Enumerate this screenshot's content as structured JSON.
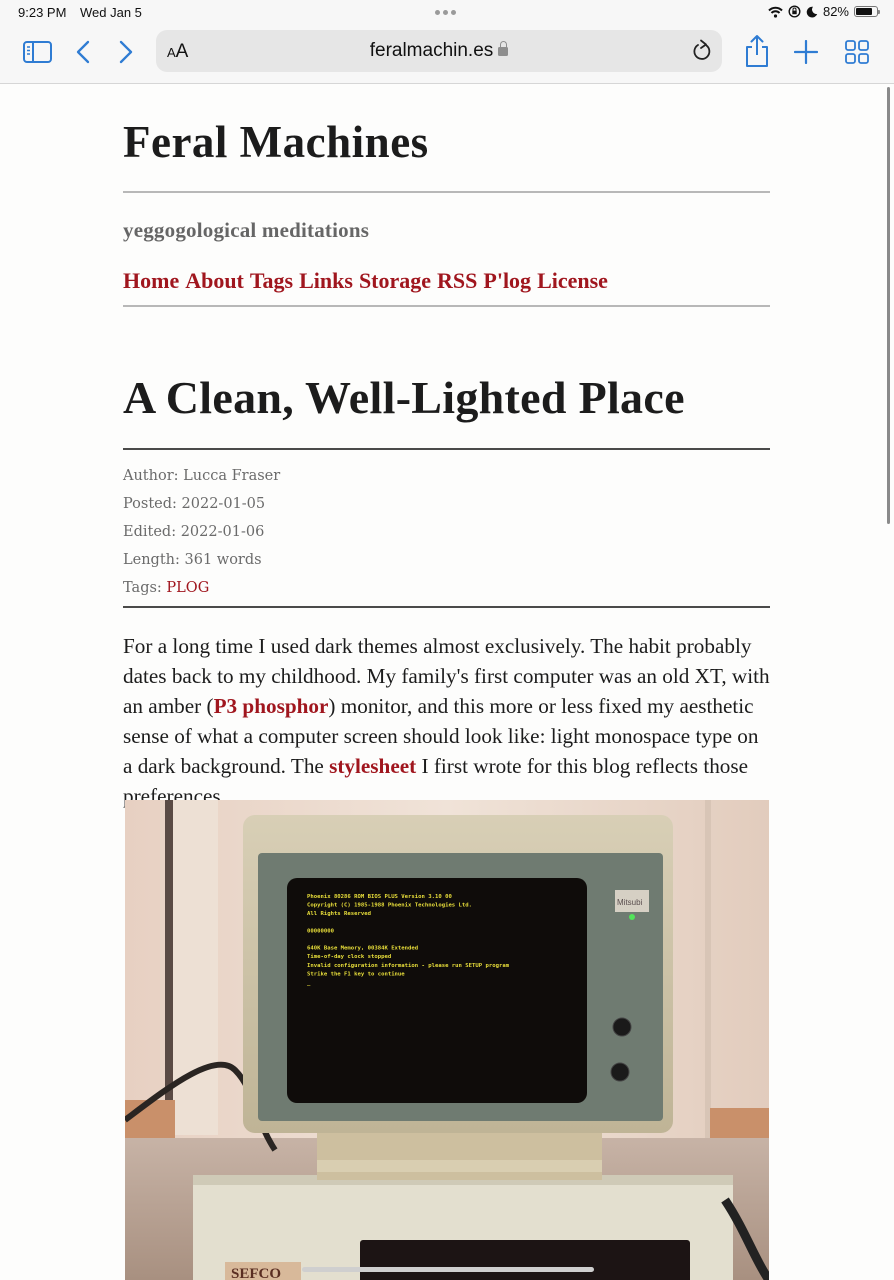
{
  "statusbar": {
    "time": "9:23 PM",
    "date": "Wed Jan 5",
    "battery_percent_label": "82%",
    "battery_level": 0.82,
    "icons": [
      "wifi-icon",
      "orientation-lock-icon",
      "do-not-disturb-moon-icon",
      "battery-icon"
    ]
  },
  "browser": {
    "text_size_label_small": "A",
    "text_size_label_large": "A",
    "url": "feralmachin.es",
    "secure": true,
    "icons": [
      "sidebar-icon",
      "back-icon",
      "forward-icon",
      "lock-icon",
      "reload-icon",
      "share-icon",
      "new-tab-icon",
      "tabs-overview-icon"
    ],
    "accent_color": "#2f7cd3"
  },
  "site": {
    "title": "Feral Machines",
    "tagline": "yeggogological meditations",
    "nav": [
      {
        "label": "Home"
      },
      {
        "label": "About"
      },
      {
        "label": "Tags"
      },
      {
        "label": "Links"
      },
      {
        "label": "Storage"
      },
      {
        "label": "RSS"
      },
      {
        "label": "P'log"
      },
      {
        "label": "License"
      }
    ],
    "link_color": "#a0161e"
  },
  "post": {
    "title": "A Clean, Well-Lighted Place",
    "meta": {
      "author_label": "Author:",
      "author": "Lucca Fraser",
      "posted_label": "Posted:",
      "posted": "2022-01-05",
      "edited_label": "Edited:",
      "edited": "2022-01-06",
      "length_label": "Length:",
      "length": "361 words",
      "tags_label": "Tags:",
      "tags": [
        "PLOG"
      ]
    },
    "paragraph": {
      "part1": "For a long time I used dark themes almost exclusively. The habit probably dates back to my childhood. My family's first computer was an old XT, with an amber (",
      "link1": "P3 phosphor",
      "part2": ") monitor, and this more or less fixed my aesthetic sense of what a computer screen should look like: light monospace type on a dark background. The ",
      "link2": "stylesheet",
      "part3": " I first wrote for this blog reflects those preferences."
    },
    "image": {
      "description": "Photo of a vintage amber-phosphor CRT monitor on an old PC case, showing Phoenix BIOS boot text",
      "screen_lines": [
        "Phoenix 80286 ROM BIOS PLUS Version 3.10 00",
        "Copyright (C) 1985-1988 Phoenix Technologies Ltd.",
        "All Rights Reserved",
        "",
        "00000000",
        "",
        "640K Base Memory, 00384K Extended",
        "Time-of-day clock stopped",
        "Invalid configuration information - please run SETUP program",
        " Strike the F1 key to continue",
        "_"
      ],
      "monitor_brand": "Mitsubishi",
      "case_brand": "SEFCO"
    }
  }
}
